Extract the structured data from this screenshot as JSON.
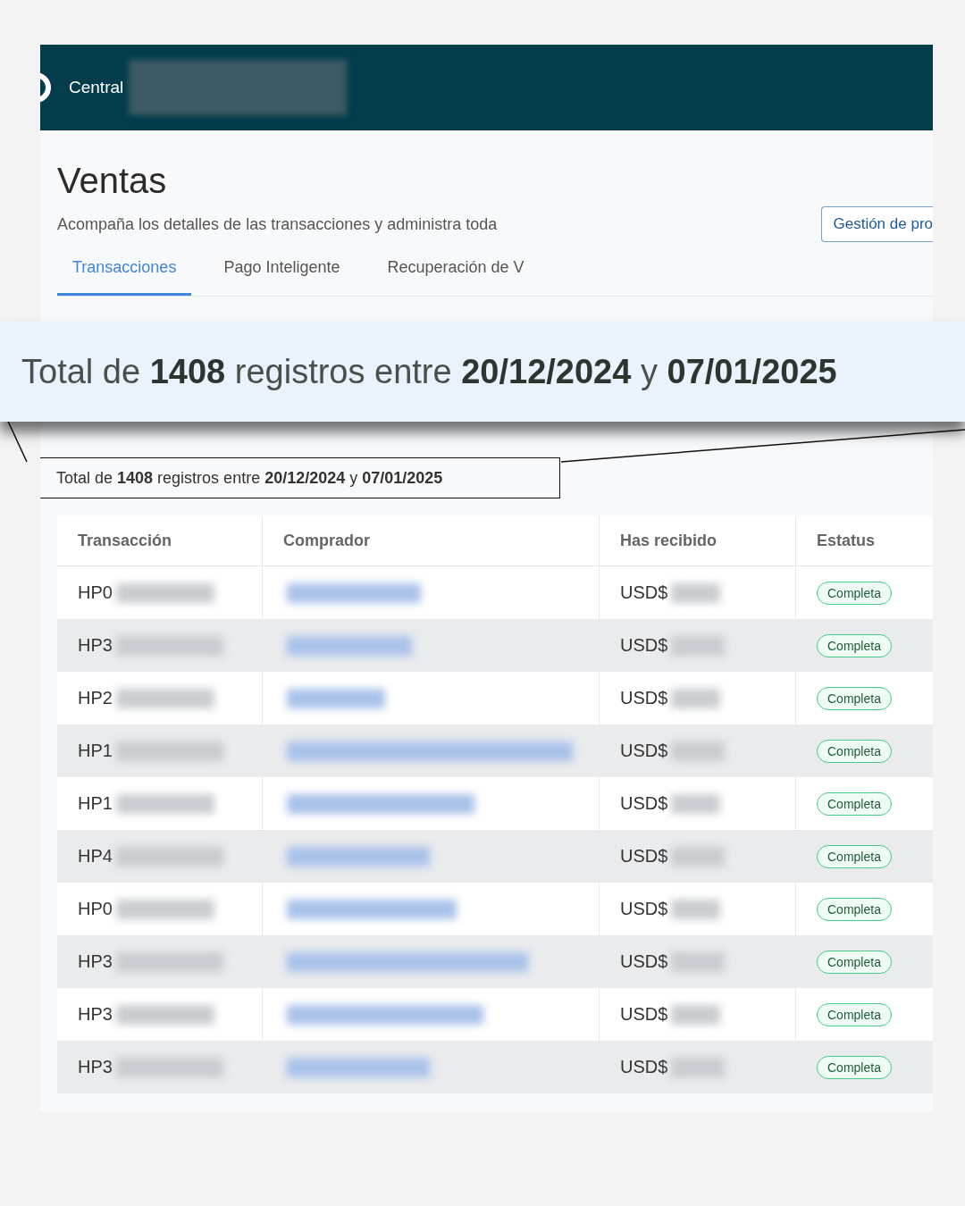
{
  "header": {
    "brand_text": "Central"
  },
  "page": {
    "title": "Ventas",
    "subtitle": "Acompaña los detalles de las transacciones y administra toda",
    "action_button": "Gestión de pro",
    "tabs": [
      {
        "label": "Transacciones",
        "selected": true
      },
      {
        "label": "Pago Inteligente",
        "selected": false
      },
      {
        "label": "Recuperación de V",
        "selected": false
      }
    ]
  },
  "callout": {
    "text": "Total de **1408** registros entre **20/12/2024** y **07/01/2025**"
  },
  "summary": {
    "text": "Total de **1408** registros entre **20/12/2024** y **07/01/2025**"
  },
  "table": {
    "columns": [
      "Transacción",
      "Comprador",
      "Has recibido",
      "Estatus"
    ],
    "rows": [
      {
        "transaction": "HP0",
        "amount": "USD$",
        "status": "Completa"
      },
      {
        "transaction": "HP3",
        "amount": "USD$",
        "status": "Completa"
      },
      {
        "transaction": "HP2",
        "amount": "USD$",
        "status": "Completa"
      },
      {
        "transaction": "HP1",
        "amount": "USD$",
        "status": "Completa"
      },
      {
        "transaction": "HP1",
        "amount": "USD$",
        "status": "Completa"
      },
      {
        "transaction": "HP4",
        "amount": "USD$",
        "status": "Completa"
      },
      {
        "transaction": "HP0",
        "amount": "USD$",
        "status": "Completa"
      },
      {
        "transaction": "HP3",
        "amount": "USD$",
        "status": "Completa"
      },
      {
        "transaction": "HP3",
        "amount": "USD$",
        "status": "Completa"
      },
      {
        "transaction": "HP3",
        "amount": "USD$",
        "status": "Completa"
      }
    ]
  }
}
